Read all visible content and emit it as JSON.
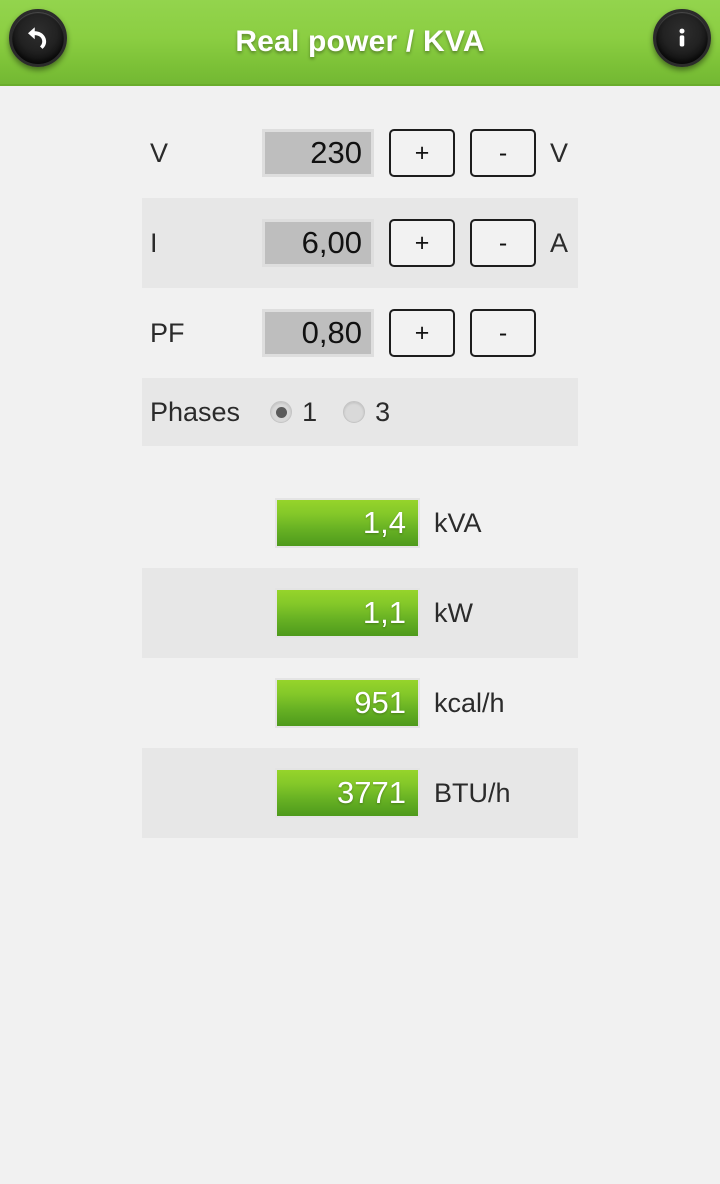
{
  "header": {
    "title": "Real power / KVA",
    "back_icon": "back-arrow-icon",
    "info_icon": "info-icon",
    "bar_color": "#8bce42"
  },
  "inputs": [
    {
      "label": "V",
      "value": "230",
      "plus": "+",
      "minus": "-",
      "unit": "V"
    },
    {
      "label": "I",
      "value": "6,00",
      "plus": "+",
      "minus": "-",
      "unit": "A"
    },
    {
      "label": "PF",
      "value": "0,80",
      "plus": "+",
      "minus": "-",
      "unit": ""
    }
  ],
  "phases": {
    "label": "Phases",
    "options": [
      {
        "text": "1",
        "selected": true
      },
      {
        "text": "3",
        "selected": false
      }
    ]
  },
  "results": [
    {
      "value": "1,4",
      "unit": "kVA"
    },
    {
      "value": "1,1",
      "unit": "kW"
    },
    {
      "value": "951",
      "unit": "kcal/h"
    },
    {
      "value": "3771",
      "unit": "BTU/h"
    }
  ],
  "colors": {
    "accent_green": "#8bce42",
    "result_green_top": "#96d42b",
    "result_green_bottom": "#4e9a1c",
    "page_background": "#f1f1f1",
    "row_stripe": "#e7e7e7"
  }
}
